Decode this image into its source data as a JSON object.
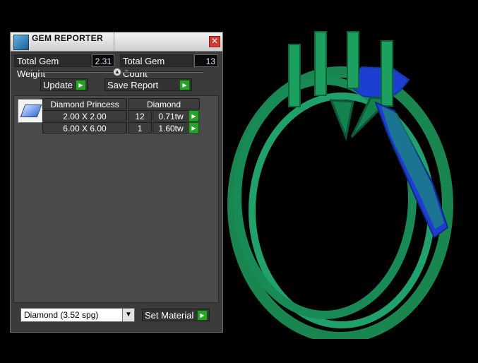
{
  "window": {
    "title": "GEM REPORTER",
    "close_glyph": "✕"
  },
  "stats": {
    "total_weight_label": "Total Gem Weight",
    "total_weight_value": "2.31",
    "total_count_label": "Total Gem Count",
    "total_count_value": "13"
  },
  "actions": {
    "update_label": "Update",
    "save_report_label": "Save Report"
  },
  "report": {
    "shape_header": "Diamond Princess",
    "material_header": "Diamond",
    "rows": [
      {
        "size": "2.00 X 2.00",
        "count": "12",
        "weight": "0.71tw"
      },
      {
        "size": "6.00 X 6.00",
        "count": "1",
        "weight": "1.60tw"
      }
    ]
  },
  "material": {
    "selected": "Diamond    (3.52 spg)",
    "set_label": "Set Material"
  },
  "icons": {
    "window_icon": "gem-reporter-icon",
    "arrow": "▶",
    "dropdown": "▼",
    "collapse": "▲"
  },
  "colors": {
    "accent_green": "#2aa12a",
    "ring_green": "#1d8b57",
    "gem_blue": "#1d3fd1"
  }
}
